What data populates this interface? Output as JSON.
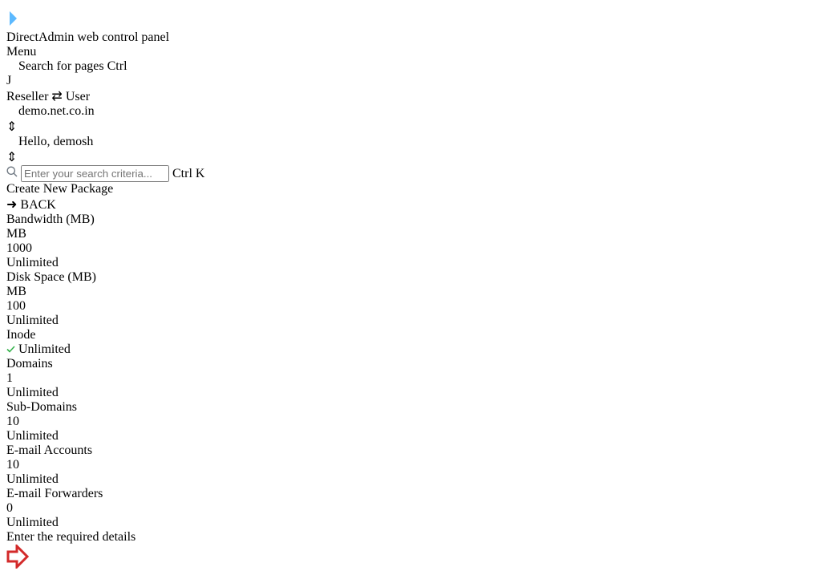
{
  "brand": {
    "name": "DirectAdmin",
    "tagline": "web control panel"
  },
  "topbar": {
    "menu_label": "Menu",
    "search_pages_label": "Search for pages",
    "search_pages_kbd": "Ctrl J",
    "reseller_label": "Reseller",
    "user_label": "User",
    "domain_label": "demo.net.co.in",
    "hello_label": "Hello, demosh"
  },
  "search": {
    "placeholder": "Enter your search criteria...",
    "kbd": "Ctrl K"
  },
  "page": {
    "title": "Create New Package",
    "back_label": "BACK"
  },
  "annotation": {
    "text": "Enter the required details",
    "color": "#d32a2a"
  },
  "unit_label": "MB",
  "unlimited_label": "Unlimited",
  "rows": [
    {
      "label": "Bandwidth (MB)",
      "value": "1000",
      "unlimited": false
    },
    {
      "label": "Disk Space (MB)",
      "value": "100",
      "unlimited": false
    },
    {
      "label": "Inode",
      "value": "",
      "unlimited": true
    },
    {
      "label": "Domains",
      "value": "1",
      "unlimited": false
    },
    {
      "label": "Sub-Domains",
      "value": "10",
      "unlimited": false
    },
    {
      "label": "E-mail Accounts",
      "value": "10",
      "unlimited": false
    },
    {
      "label": "E-mail Forwarders",
      "value": "0",
      "unlimited": false
    }
  ],
  "colors": {
    "header": "#1e4f96",
    "accent": "#2b9af3",
    "highlight": "#e2202a"
  }
}
